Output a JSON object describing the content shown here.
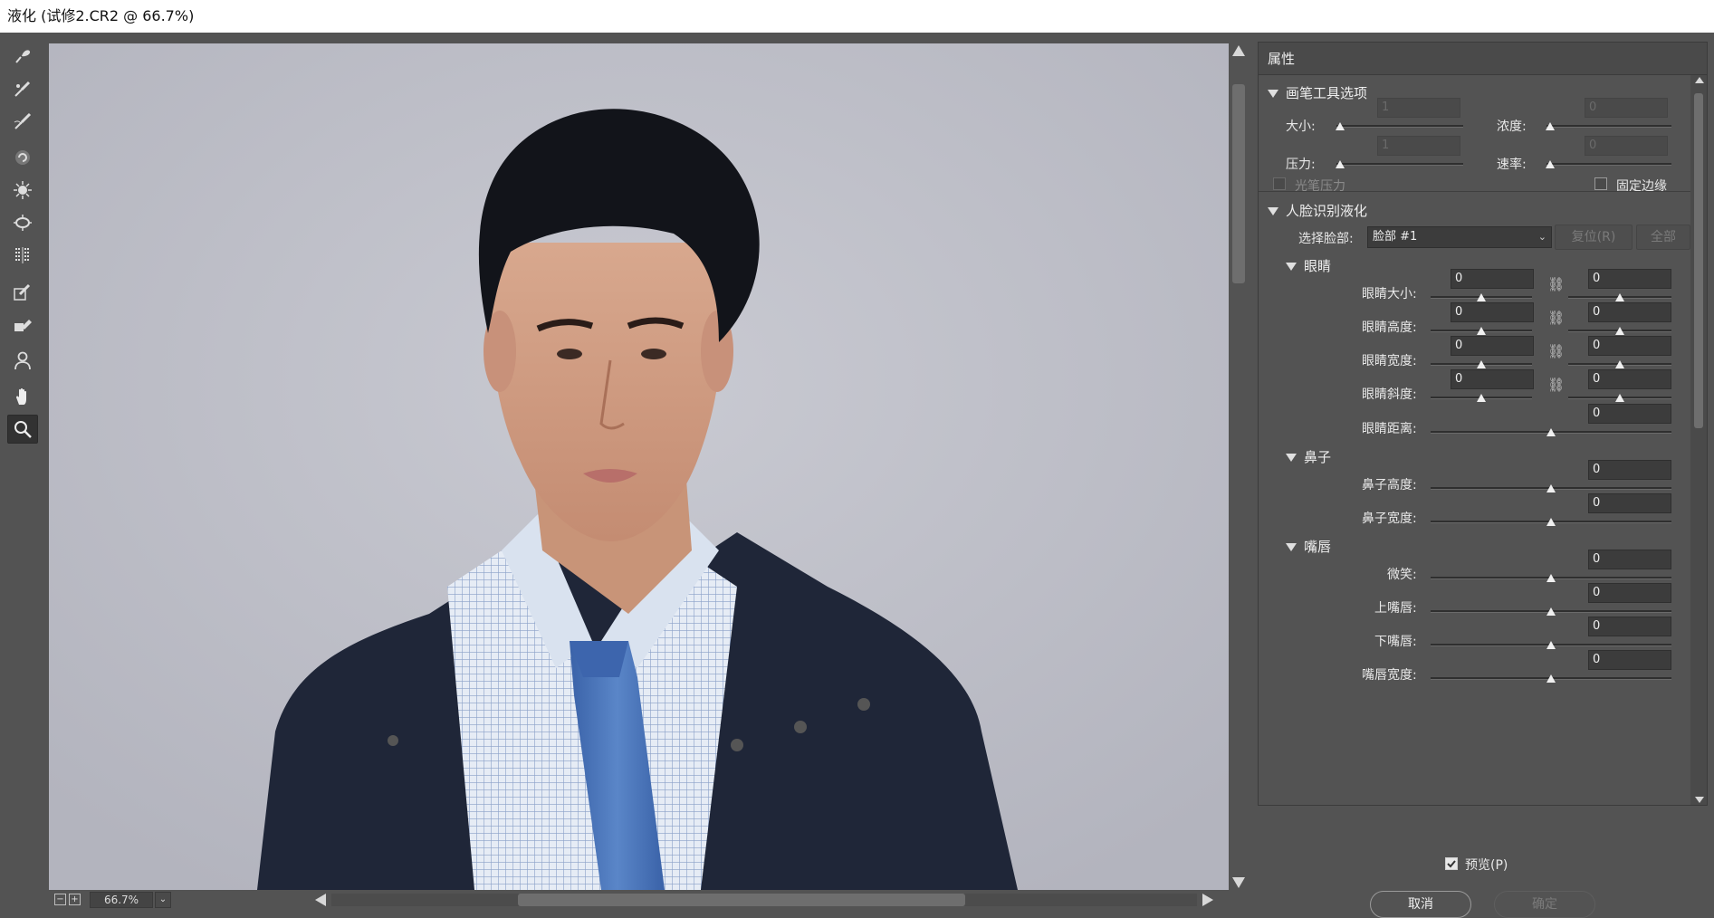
{
  "window": {
    "title": "液化 (试修2.CR2 @ 66.7%)"
  },
  "toolbar": {
    "tools": [
      {
        "name": "forward-warp-tool",
        "icon": "warp-brush-icon"
      },
      {
        "name": "reconstruct-tool",
        "icon": "reconstruct-brush-icon"
      },
      {
        "name": "smooth-tool",
        "icon": "smooth-brush-icon"
      },
      {
        "name": "twirl-tool",
        "icon": "twirl-icon"
      },
      {
        "name": "pucker-tool",
        "icon": "pucker-icon"
      },
      {
        "name": "bloat-tool",
        "icon": "bloat-icon"
      },
      {
        "name": "push-left-tool",
        "icon": "push-left-icon"
      },
      {
        "name": "freeze-mask-tool",
        "icon": "freeze-mask-icon"
      },
      {
        "name": "thaw-mask-tool",
        "icon": "thaw-mask-icon"
      },
      {
        "name": "face-tool",
        "icon": "face-tool-icon"
      },
      {
        "name": "hand-tool",
        "icon": "hand-icon"
      },
      {
        "name": "zoom-tool",
        "icon": "magnifier-icon",
        "active": true
      }
    ]
  },
  "statusbar": {
    "zoom": "66.7%",
    "zoom_out": "−",
    "zoom_in": "+"
  },
  "properties": {
    "header": "属性",
    "brush_section": {
      "title": "画笔工具选项",
      "size_label": "大小:",
      "size_value": "1",
      "density_label": "浓度:",
      "density_value": "0",
      "pressure_label": "压力:",
      "pressure_value": "1",
      "rate_label": "速率:",
      "rate_value": "0",
      "stylus_label": "光笔压力",
      "pin_edges_label": "固定边缘"
    },
    "face_section": {
      "title": "人脸识别液化",
      "select_face_label": "选择脸部:",
      "select_face_value": "脸部 #1",
      "reset_label": "复位(R)",
      "all_label": "全部",
      "eyes": {
        "title": "眼睛",
        "size_label": "眼睛大小:",
        "size_left": "0",
        "size_right": "0",
        "height_label": "眼睛高度:",
        "height_left": "0",
        "height_right": "0",
        "width_label": "眼睛宽度:",
        "width_left": "0",
        "width_right": "0",
        "tilt_label": "眼睛斜度:",
        "tilt_left": "0",
        "tilt_right": "0",
        "distance_label": "眼睛距离:",
        "distance_value": "0"
      },
      "nose": {
        "title": "鼻子",
        "height_label": "鼻子高度:",
        "height_value": "0",
        "width_label": "鼻子宽度:",
        "width_value": "0"
      },
      "mouth": {
        "title": "嘴唇",
        "smile_label": "微笑:",
        "smile_value": "0",
        "upper_label": "上嘴唇:",
        "upper_value": "0",
        "lower_label": "下嘴唇:",
        "lower_value": "0",
        "width_label": "嘴唇宽度:",
        "width_value": "0"
      }
    }
  },
  "footer": {
    "preview_label": "预览(P)",
    "cancel_label": "取消",
    "ok_label": "确定"
  },
  "colors": {
    "panel_bg": "#535353",
    "canvas_bg": "#bfc0c8",
    "titlebar_bg": "#ffffff"
  }
}
